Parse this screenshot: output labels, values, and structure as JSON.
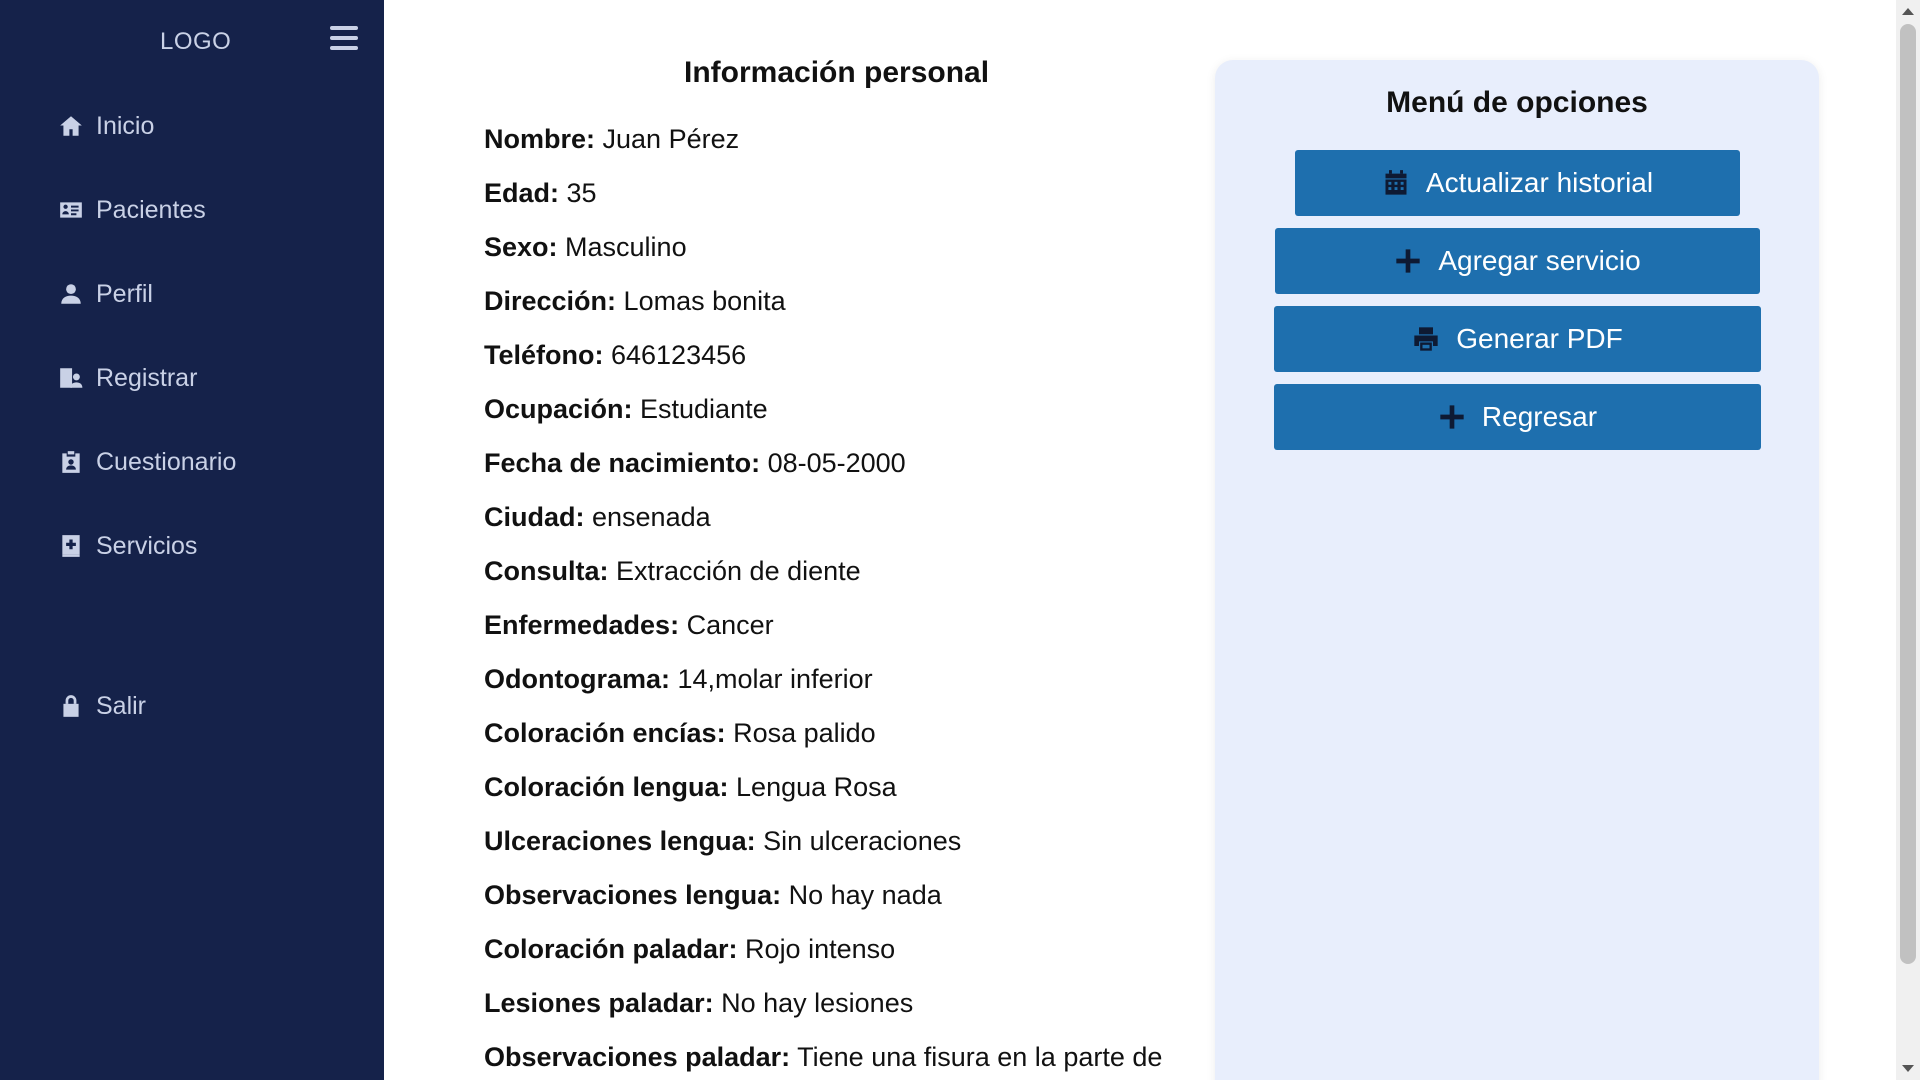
{
  "sidebar": {
    "logo": "LOGO",
    "items": [
      {
        "label": "Inicio",
        "icon": "home-icon"
      },
      {
        "label": "Pacientes",
        "icon": "id-card-icon"
      },
      {
        "label": "Perfil",
        "icon": "user-icon"
      },
      {
        "label": "Registrar",
        "icon": "user-register-icon"
      },
      {
        "label": "Cuestionario",
        "icon": "clipboard-user-icon"
      },
      {
        "label": "Servicios",
        "icon": "medical-plus-icon"
      }
    ],
    "logout": {
      "label": "Salir",
      "icon": "lock-icon"
    }
  },
  "info": {
    "title": "Información personal",
    "fields": [
      {
        "key": "Nombre:",
        "value": " Juan Pérez"
      },
      {
        "key": "Edad:",
        "value": " 35"
      },
      {
        "key": "Sexo:",
        "value": " Masculino"
      },
      {
        "key": "Dirección:",
        "value": " Lomas bonita"
      },
      {
        "key": "Teléfono:",
        "value": " 646123456"
      },
      {
        "key": "Ocupación:",
        "value": " Estudiante"
      },
      {
        "key": "Fecha de nacimiento:",
        "value": " 08-05-2000"
      },
      {
        "key": "Ciudad:",
        "value": " ensenada"
      },
      {
        "key": "Consulta:",
        "value": " Extracción de diente"
      },
      {
        "key": "Enfermedades:",
        "value": " Cancer"
      },
      {
        "key": "Odontograma:",
        "value": " 14,molar inferior"
      },
      {
        "key": "Coloración encías:",
        "value": " Rosa palido"
      },
      {
        "key": "Coloración lengua:",
        "value": " Lengua Rosa"
      },
      {
        "key": "Ulceraciones lengua:",
        "value": " Sin ulceraciones"
      },
      {
        "key": "Observaciones lengua:",
        "value": " No hay nada"
      },
      {
        "key": "Coloración paladar:",
        "value": " Rojo intenso"
      },
      {
        "key": "Lesiones paladar:",
        "value": " No hay lesiones"
      },
      {
        "key": "Observaciones paladar:",
        "value": " Tiene una fisura en la parte de"
      }
    ]
  },
  "options": {
    "title": "Menú de opciones",
    "buttons": [
      {
        "label": "Actualizar historial",
        "icon": "calendar-icon"
      },
      {
        "label": "Agregar servicio",
        "icon": "plus-icon"
      },
      {
        "label": "Generar PDF",
        "icon": "printer-icon"
      },
      {
        "label": "Regresar",
        "icon": "plus-icon"
      }
    ]
  },
  "colors": {
    "sidebar_bg": "#15224a",
    "sidebar_text": "#c9d1e6",
    "panel_bg": "#e8eefc",
    "button_bg": "#1e6fae"
  }
}
